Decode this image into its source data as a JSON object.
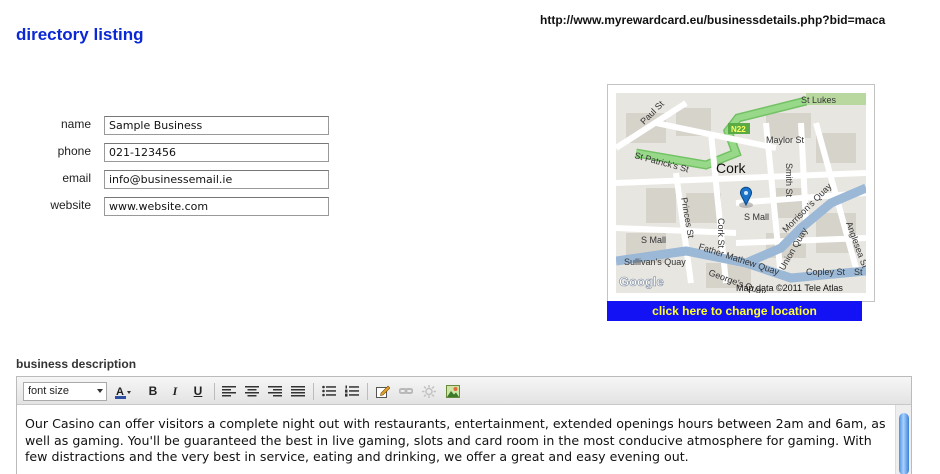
{
  "page": {
    "title": "directory listing",
    "url": "http://www.myrewardcard.eu/businessdetails.php?bid=maca"
  },
  "form": {
    "name": {
      "label": "name",
      "value": "Sample Business"
    },
    "phone": {
      "label": "phone",
      "value": "021-123456"
    },
    "email": {
      "label": "email",
      "value": "info@businessemail.ie"
    },
    "website": {
      "label": "website",
      "value": "www.website.com"
    }
  },
  "map": {
    "city": "Cork",
    "streets": [
      "St Lukes",
      "Paul St",
      "N22",
      "Maylor St",
      "St Patrick's St",
      "Cork St",
      "S Mall",
      "Smith St",
      "Princes St",
      "S Mall",
      "Father Mathew Quay",
      "Sullivan's Quay",
      "George's Quay",
      "Union Quay",
      "Morrison's Quay",
      "Anglesea St",
      "Copley St",
      "St"
    ],
    "attribution": "Map data ©2011 Tele Atlas",
    "google_logo": "Google",
    "change_location_label": "click here to change location",
    "marker_color": "#1a73c9"
  },
  "description": {
    "label": "business description",
    "font_select": "font size",
    "text": "Our Casino can offer visitors a complete night out with restaurants, entertainment, extended openings hours between 2am and 6am, as well as gaming. You'll be guaranteed the best in live gaming, slots and card room in the most conducive atmosphere for gaming. With few distractions and the very best in service, eating and drinking, we offer a great and easy evening out."
  },
  "toolbar": {
    "bold": "B",
    "italic": "I",
    "underline": "U",
    "icons": [
      "font-color-icon",
      "bold-icon",
      "italic-icon",
      "underline-icon",
      "align-left-icon",
      "align-center-icon",
      "align-right-icon",
      "align-justify-icon",
      "bullet-list-icon",
      "numbered-list-icon",
      "edit-html-icon",
      "link-icon",
      "unlink-icon",
      "insert-image-icon"
    ]
  },
  "colors": {
    "title": "#0b28d6",
    "button_bg": "#1212f4",
    "button_text": "#ffff33"
  }
}
